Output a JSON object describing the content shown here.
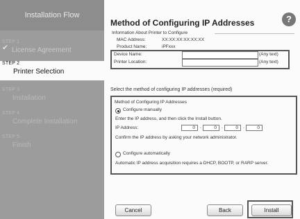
{
  "sidebar": {
    "title": "Installation Flow",
    "steps": [
      {
        "num": "STEP 1",
        "name": "License Agreement",
        "status": "completed"
      },
      {
        "num": "STEP 2",
        "name": "Printer Selection",
        "status": "current"
      },
      {
        "num": "STEP 3",
        "name": "Installation",
        "status": "pending"
      },
      {
        "num": "STEP 4",
        "name": "Complete Installation",
        "status": "pending"
      },
      {
        "num": "STEP 5",
        "name": "Finish",
        "status": "pending"
      }
    ]
  },
  "header": {
    "title": "Method of Configuring IP Addresses",
    "help_icon": "?"
  },
  "printer_info": {
    "group_title": "Information About Printer to Configure",
    "mac_label": "MAC Address:",
    "mac_value": "XX:XX:XX:XX:XX:XX",
    "product_label": "Product Name:",
    "product_value": "iPFxxx",
    "device_label": "Device Name:",
    "device_value": "",
    "device_hint": "(Any text)",
    "location_label": "Printer Location:",
    "location_value": "",
    "location_hint": "(Any text)"
  },
  "method": {
    "caption": "Select the method of configuring IP addresses (required)",
    "group_title": "Method of Configuring IP Addresses",
    "manual_label": "Configure manually",
    "manual_selected": true,
    "manual_help": "Enter the IP address, and then click the Install button.",
    "ip_label": "IP Address:",
    "ip_octets": [
      "0",
      "0",
      "0",
      "0"
    ],
    "confirm_text": "Confirm the IP address by asking your network administrator.",
    "auto_label": "Configure automatically",
    "auto_selected": false,
    "auto_help": "Automatic IP address acquisition requires a DHCP, BOOTP, or RARP server."
  },
  "buttons": {
    "cancel": "Cancel",
    "back": "Back",
    "install": "Install"
  }
}
